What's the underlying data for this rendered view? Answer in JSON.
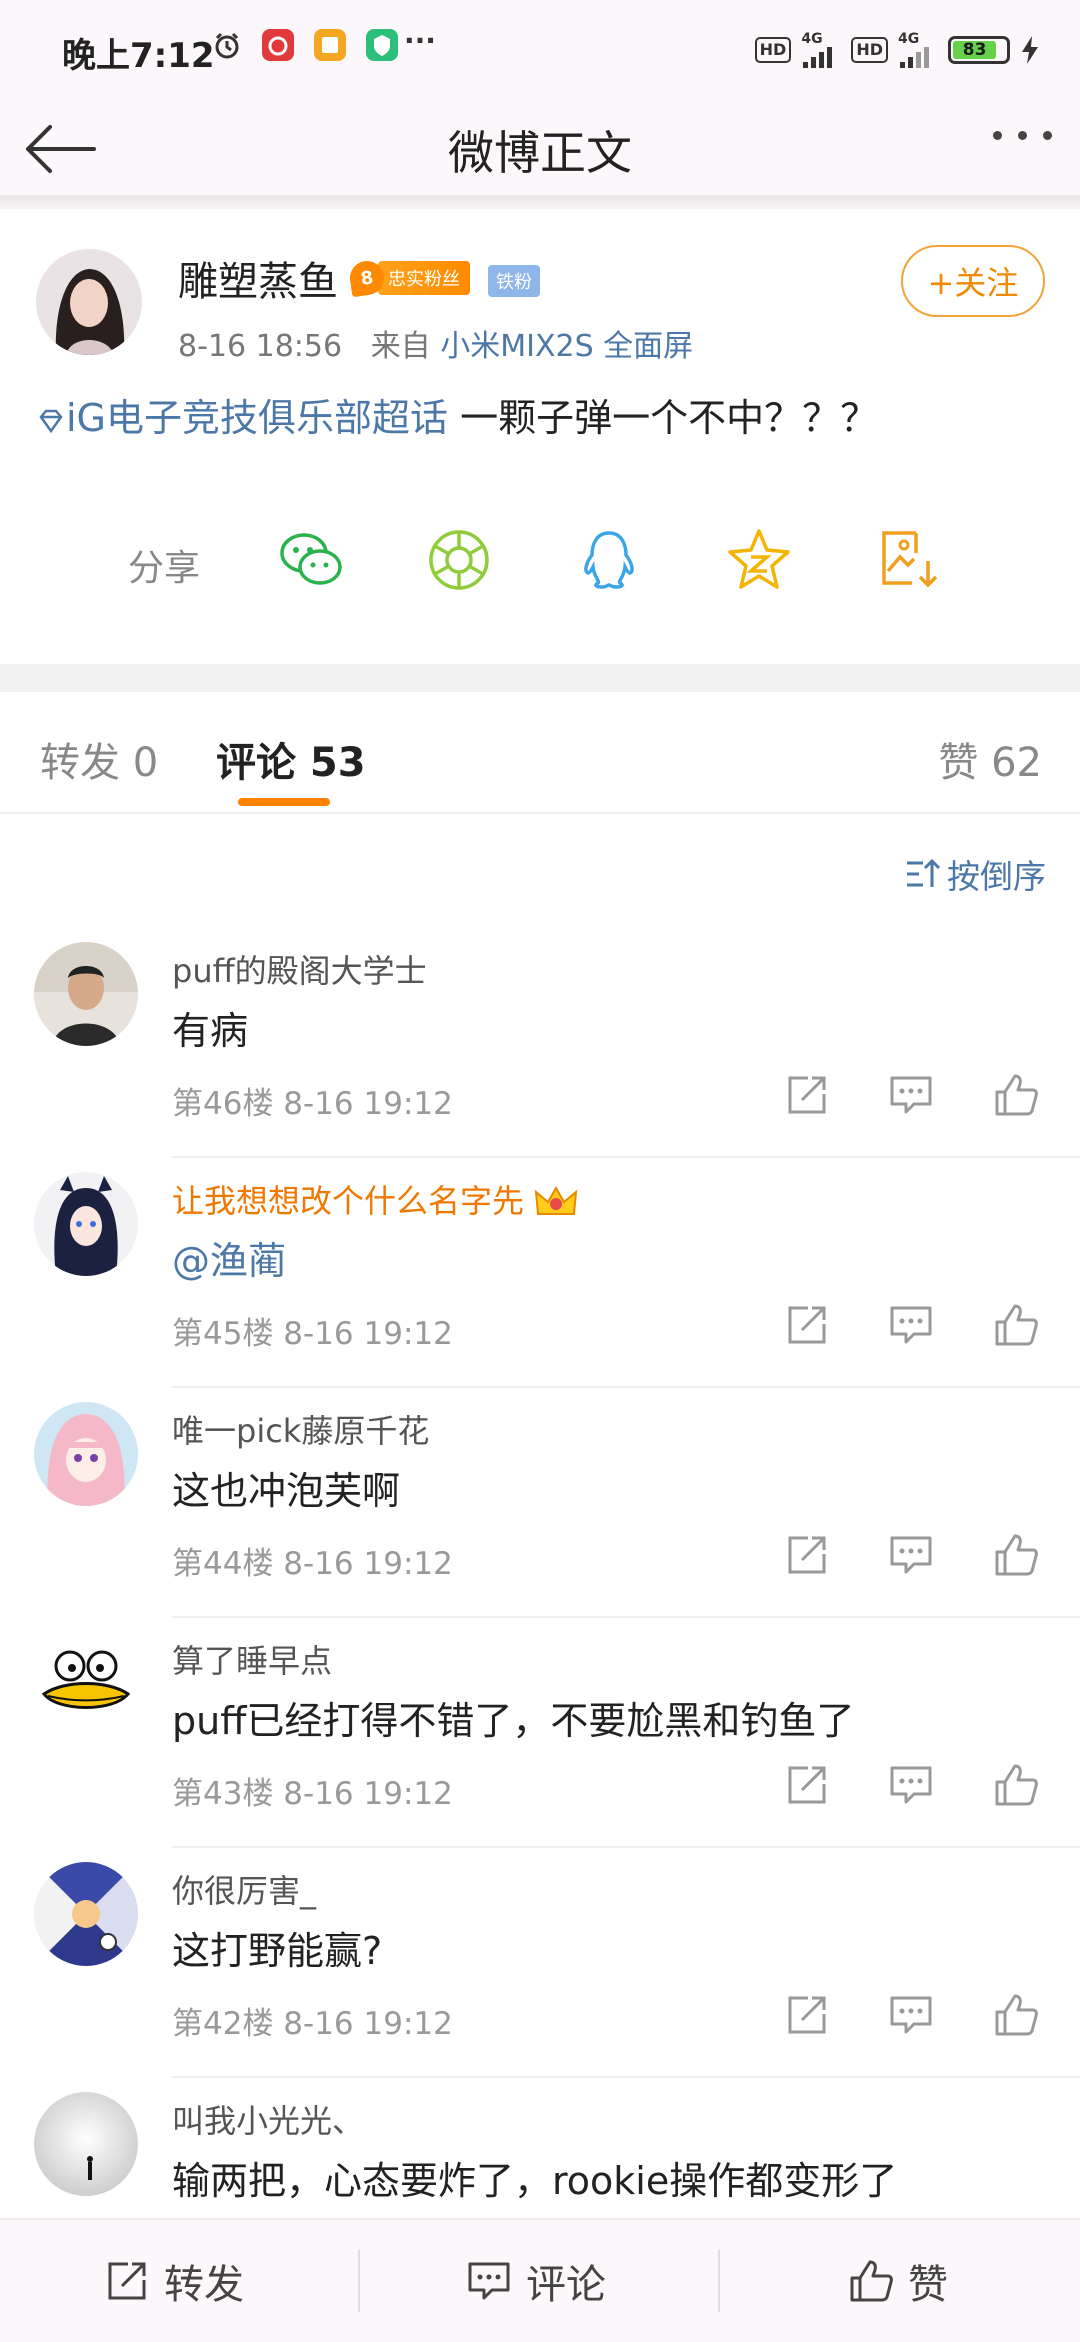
{
  "status_bar": {
    "time": "晚上7:12",
    "hd1": "HD",
    "net1": "4G",
    "hd2": "HD",
    "net2": "4G",
    "battery": "83",
    "more": "···"
  },
  "header": {
    "title": "微博正文"
  },
  "post": {
    "author": "雕塑蒸鱼",
    "fan_level": "8",
    "fan_badge": "忠实粉丝",
    "iron_badge": "铁粉",
    "time": "8-16 18:56",
    "source_prefix": "来自",
    "source": "小米MIX2S 全面屏",
    "follow_label": "+关注",
    "topic": "iG电子竞技俱乐部超话",
    "text": " 一颗子弹一个不中？？？",
    "share_label": "分享"
  },
  "tabs": {
    "repost": "转发 0",
    "comment": "评论 53",
    "like": "赞 62"
  },
  "sort_label": "按倒序",
  "comments": [
    {
      "name": "puff的殿阁大学士",
      "text": "有病",
      "floor": "第46楼 8-16 19:12"
    },
    {
      "name": "让我想想改个什么名字先",
      "text": "@渔蔺",
      "floor": "第45楼 8-16 19:12"
    },
    {
      "name": "唯一pick藤原千花",
      "text": "这也冲泡芙啊",
      "floor": "第44楼 8-16 19:12"
    },
    {
      "name": "算了睡早点",
      "text": "puff已经打得不错了，不要尬黑和钓鱼了",
      "floor": "第43楼 8-16 19:12"
    },
    {
      "name": "你很厉害_",
      "text": "这打野能赢?",
      "floor": "第42楼 8-16 19:12"
    },
    {
      "name": "叫我小光光、",
      "text": "输两把，心态要炸了，rookie操作都变形了",
      "floor": ""
    }
  ],
  "bottom_bar": {
    "repost": "转发",
    "comment": "评论",
    "like": "赞"
  },
  "colors": {
    "accent_orange": "#ff8200",
    "link_blue": "#4c78a8",
    "vip_name": "#f07800"
  }
}
